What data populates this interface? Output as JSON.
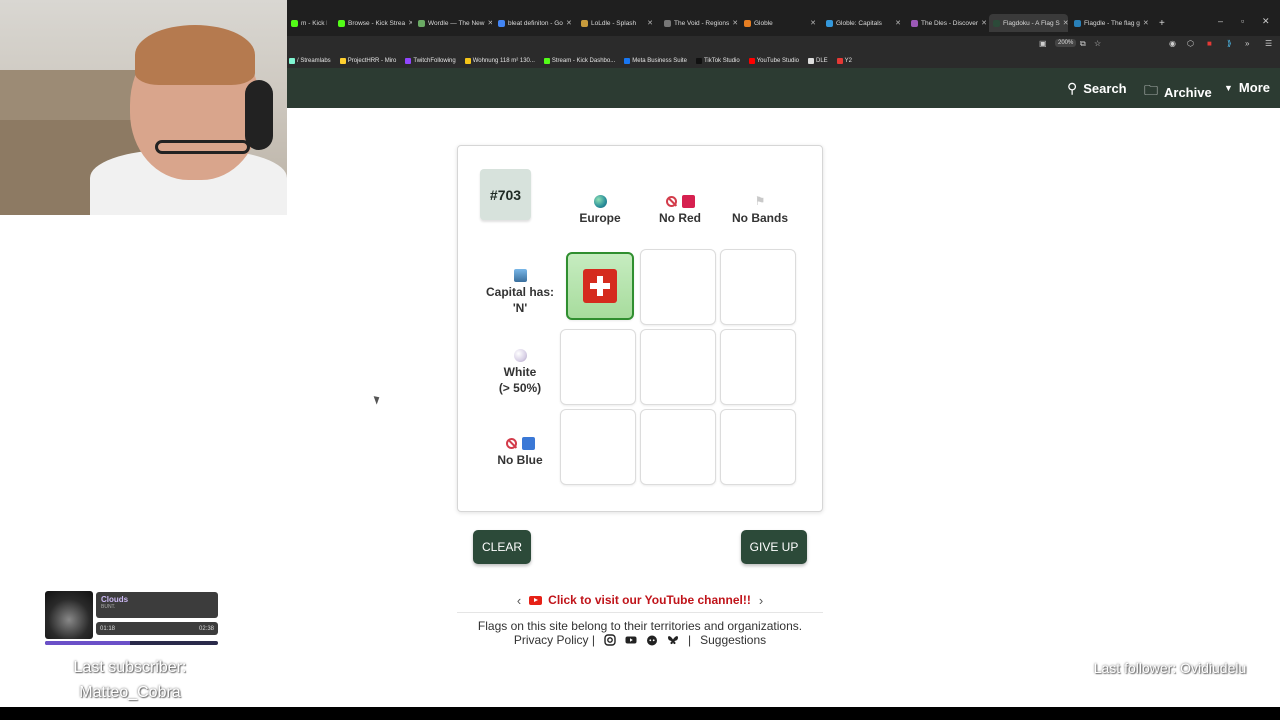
{
  "browser": {
    "tabs": [
      {
        "title": "m - Kick D",
        "color": "#53fc18"
      },
      {
        "title": "Browse - Kick Strea",
        "color": "#53fc18"
      },
      {
        "title": "Wordle — The New",
        "color": "#6aaa64"
      },
      {
        "title": "bleat definiton - Go",
        "color": "#4285f4"
      },
      {
        "title": "LoLdle - Splash",
        "color": "#c89b3c"
      },
      {
        "title": "The Void - Regions",
        "color": "#777777"
      },
      {
        "title": "Globle",
        "color": "#e67e22"
      },
      {
        "title": "Globle: Capitals",
        "color": "#3498db"
      },
      {
        "title": "The Dles - Discover",
        "color": "#9b59b6"
      },
      {
        "title": "Flagdoku - A Flag S",
        "color": "#2c4a39"
      },
      {
        "title": "Flagdle - The flag g",
        "color": "#2980b9"
      }
    ],
    "active_tab_index": 9,
    "new_tab": "+",
    "zoom": "200%",
    "bookmarks": [
      {
        "label": "/ Streamlabs",
        "color": "#80f5d2"
      },
      {
        "label": "ProjectHRR - Miro",
        "color": "#ffd02f"
      },
      {
        "label": "TwitchFollowing",
        "color": "#9146ff"
      },
      {
        "label": "Wohnung 118 m² 130...",
        "color": "#f5c518"
      },
      {
        "label": "Stream - Kick Dashbo...",
        "color": "#53fc18"
      },
      {
        "label": "Meta Business Suite",
        "color": "#1877f2"
      },
      {
        "label": "TikTok Studio",
        "color": "#111111"
      },
      {
        "label": "YouTube Studio",
        "color": "#ff0000"
      },
      {
        "label": "DLE",
        "color": "#dddddd"
      },
      {
        "label": "Y2",
        "color": "#e53935"
      }
    ]
  },
  "site_nav": {
    "search": "Search",
    "archive": "Archive",
    "more": "More"
  },
  "game": {
    "puzzle_number": "#703",
    "columns": [
      {
        "label": "Europe",
        "icon": "globe-icon"
      },
      {
        "label": "No Red",
        "icon": "no-red-icon",
        "color": "#d6204f"
      },
      {
        "label": "No Bands",
        "icon": "flag-icon"
      }
    ],
    "rows": [
      {
        "label_line1": "Capital has:",
        "label_line2": "'N'",
        "icon": "city-icon"
      },
      {
        "label_line1": "White",
        "label_line2": "(> 50%)",
        "icon": "pearl-icon"
      },
      {
        "label_line1": "No Blue",
        "label_line2": "",
        "icon": "no-blue-icon",
        "color": "#3a78d6"
      }
    ],
    "filled_cell": {
      "row": 0,
      "col": 0,
      "flag": "Switzerland"
    },
    "clear_label": "CLEAR",
    "giveup_label": "GIVE UP"
  },
  "promo": {
    "prev": "‹",
    "text": "Click to visit our YouTube channel!!",
    "next": "›"
  },
  "footer": {
    "line1": "Flags on this site belong to their territories and organizations.",
    "privacy": "Privacy Policy |",
    "separator": "|",
    "suggestions": "Suggestions"
  },
  "stream": {
    "track_title": "Clouds",
    "track_artist": "BUNT.",
    "time_elapsed": "01:18",
    "time_total": "02:38",
    "progress": 0.49,
    "last_subscriber_label": "Last subscriber:",
    "last_subscriber_name": "Matteo_Cobra",
    "last_follower": "Last follower: Ovidiudelu"
  },
  "colors": {
    "header_bg": "#2c3b32",
    "button_bg": "#2c4a39",
    "selected_cell": "#a7dc9d",
    "promo_text": "#c0141a"
  }
}
